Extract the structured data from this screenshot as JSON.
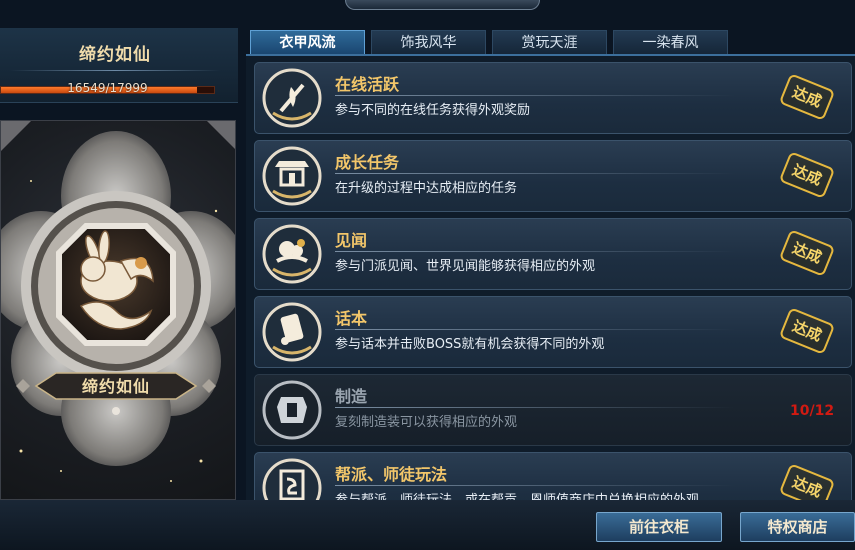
{
  "header": {
    "banner_text": ""
  },
  "left_panel": {
    "title": "缔约如仙",
    "progress_text": "16549/17999",
    "progress_fraction": 0.9194,
    "emblem_label": "缔约如仙",
    "emblem_icon": "rabbit-emblem-icon"
  },
  "tabs": [
    {
      "label": "衣甲风流",
      "active": true
    },
    {
      "label": "饰我风华",
      "active": false
    },
    {
      "label": "赏玩天涯",
      "active": false
    },
    {
      "label": "一染春风",
      "active": false
    }
  ],
  "tasks": [
    {
      "title": "在线活跃",
      "desc": "参与不同的在线任务获得外观奖励",
      "status": "达成",
      "icon": "flame-sword-icon"
    },
    {
      "title": "成长任务",
      "desc": "在升级的过程中达成相应的任务",
      "status": "达成",
      "icon": "pavilion-icon"
    },
    {
      "title": "见闻",
      "desc": "参与门派见闻、世界见闻能够获得相应的外观",
      "status": "达成",
      "icon": "cloud-teapot-icon"
    },
    {
      "title": "话本",
      "desc": "参与话本并击败BOSS就有机会获得不同的外观",
      "status": "达成",
      "icon": "scroll-icon"
    },
    {
      "title": "制造",
      "desc": "复刻制造装可以获得相应的外观",
      "status": "10/12",
      "icon": "armor-icon"
    },
    {
      "title": "帮派、师徒玩法",
      "desc": "参与帮派、师徒玩法，或在帮贡、恩师值商店中兑换相应的外观",
      "status": "达成",
      "icon": "banner-icon"
    }
  ],
  "buttons": {
    "wardrobe": "前往衣柜",
    "shop": "特权商店"
  },
  "colors": {
    "accent_gold": "#f2c66a",
    "progress_orange": "#ff7a2b",
    "count_red": "#d11a12",
    "tab_active": "#2f6a99"
  }
}
